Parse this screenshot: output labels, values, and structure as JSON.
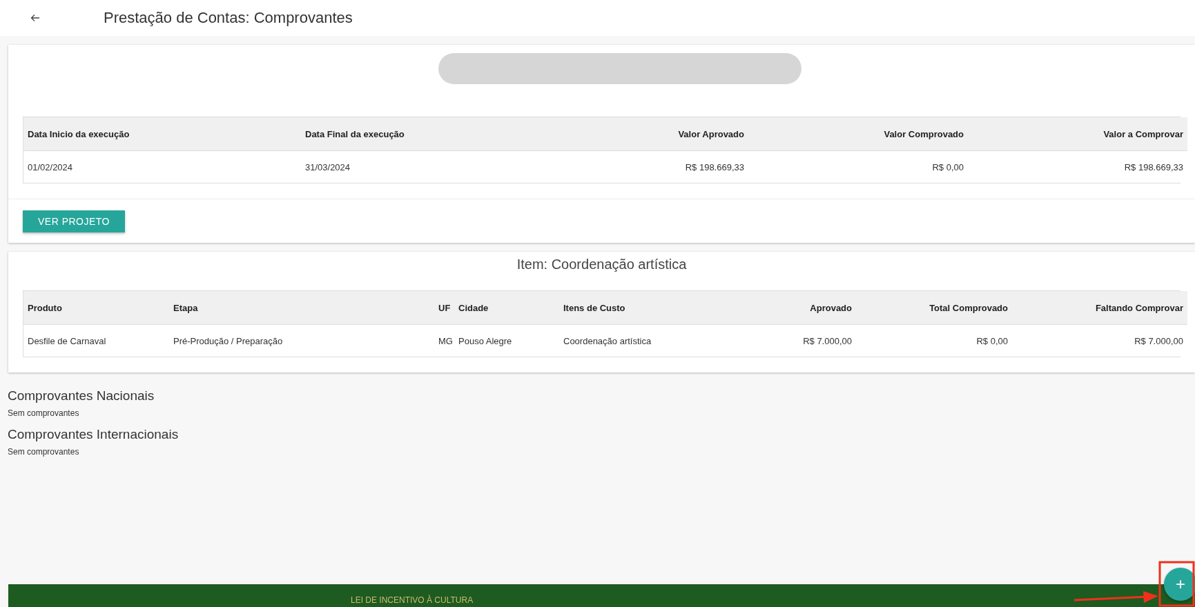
{
  "header": {
    "title": "Prestação de Contas: Comprovantes"
  },
  "summary": {
    "table": {
      "columns": [
        "Data Inicio da execução",
        "Data Final da execução",
        "Valor Aprovado",
        "Valor Comprovado",
        "Valor a Comprovar"
      ],
      "rows": [
        [
          "01/02/2024",
          "31/03/2024",
          "R$ 198.669,33",
          "R$ 0,00",
          "R$ 198.669,33"
        ]
      ]
    },
    "button": "VER PROJETO"
  },
  "item": {
    "title": "Item: Coordenação artística",
    "table": {
      "columns": [
        "Produto",
        "Etapa",
        "UF",
        "Cidade",
        "Itens de Custo",
        "Aprovado",
        "Total Comprovado",
        "Faltando Comprovar"
      ],
      "rows": [
        [
          "Desfile de Carnaval",
          "Pré-Produção / Preparação",
          "MG",
          "Pouso Alegre",
          "Coordenação artística",
          "R$ 7.000,00",
          "R$ 0,00",
          "R$ 7.000,00"
        ]
      ]
    }
  },
  "sections": [
    {
      "heading": "Comprovantes Nacionais",
      "empty_text": "Sem comprovantes"
    },
    {
      "heading": "Comprovantes Internacionais",
      "empty_text": "Sem comprovantes"
    }
  ],
  "footer": {
    "text": "LEI DE INCENTIVO À CULTURA"
  },
  "fab": {
    "label": "+"
  }
}
